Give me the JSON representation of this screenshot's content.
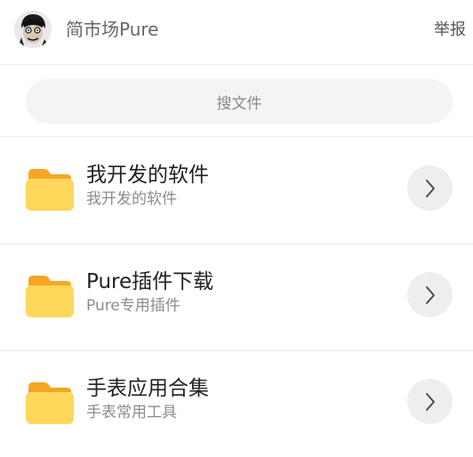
{
  "header": {
    "owner_name": "简市场Pure",
    "report_label": "举报"
  },
  "search": {
    "placeholder": "搜文件"
  },
  "folders": [
    {
      "title": "我开发的软件",
      "subtitle": "我开发的软件",
      "icon": "folder-icon"
    },
    {
      "title": "Pure插件下载",
      "subtitle": "Pure专用插件",
      "icon": "folder-icon"
    },
    {
      "title": "手表应用合集",
      "subtitle": "手表常用工具",
      "icon": "folder-icon"
    }
  ],
  "colors": {
    "folder_back": "#F5A623",
    "folder_front": "#FFD75A",
    "arrow_circle": "#EEEEEE",
    "divider": "#ECECEC"
  }
}
